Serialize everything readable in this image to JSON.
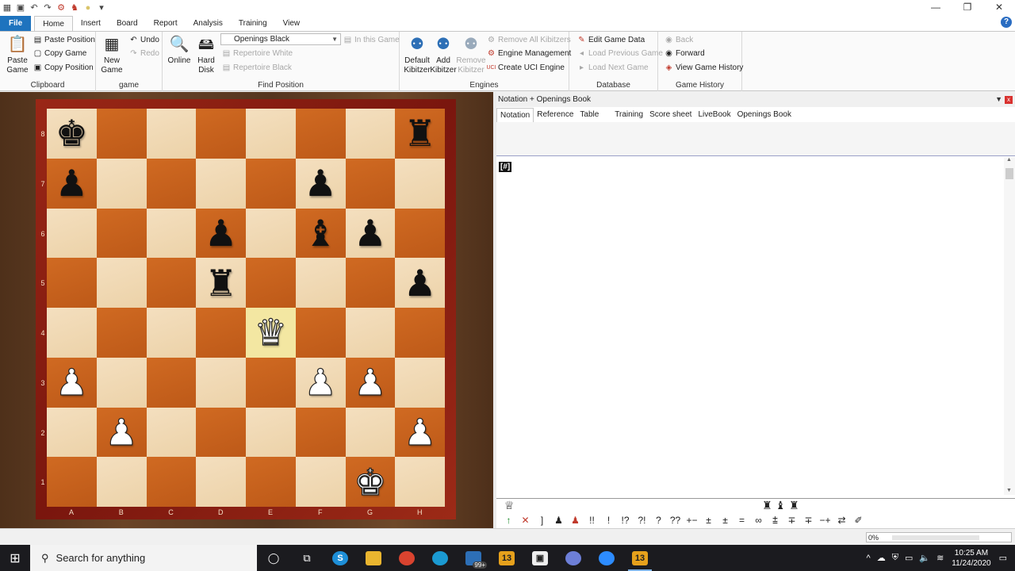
{
  "titlebar": {
    "minimize": "—",
    "maximize": "❐",
    "close": "✕"
  },
  "tabs": [
    "File",
    "Home",
    "Insert",
    "Board",
    "Report",
    "Analysis",
    "Training",
    "View"
  ],
  "help": "?",
  "ribbon": {
    "clipboard": {
      "label": "Clipboard",
      "paste_game": "Paste Game",
      "paste_position": "Paste Position",
      "copy_game": "Copy Game",
      "copy_position": "Copy Position"
    },
    "game": {
      "label": "game",
      "new_game": "New Game",
      "undo": "Undo",
      "redo": "Redo"
    },
    "find": {
      "label": "Find Position",
      "online": "Online",
      "hard_disk": "Hard Disk",
      "opening_select": "Openings Black",
      "in_this_game": "In this Game",
      "repertoire_white": "Repertoire White",
      "repertoire_black": "Repertoire Black"
    },
    "engines": {
      "label": "Engines",
      "default_kibitzer": "Default Kibitzer",
      "add_kibitzer": "Add Kibitzer",
      "remove_kibitzer": "Remove Kibitzer",
      "remove_all": "Remove All Kibitzers",
      "engine_management": "Engine Management",
      "create_uci": "Create UCI Engine"
    },
    "database": {
      "label": "Database",
      "edit_game_data": "Edit Game Data",
      "load_previous": "Load Previous Game",
      "load_next": "Load Next Game"
    },
    "history": {
      "label": "Game History",
      "back": "Back",
      "forward": "Forward",
      "view_history": "View Game History"
    }
  },
  "board": {
    "ranks": [
      "8",
      "7",
      "6",
      "5",
      "4",
      "3",
      "2",
      "1"
    ],
    "files": [
      "A",
      "B",
      "C",
      "D",
      "E",
      "F",
      "G",
      "H"
    ],
    "highlight": "e4",
    "pieces": {
      "a8": "bK",
      "h8": "bR",
      "a7": "bP",
      "f7": "bP",
      "d6": "bP",
      "f6": "bB",
      "g6": "bP",
      "d5": "bR",
      "h5": "bP",
      "e4": "wQ",
      "a3": "wP",
      "f3": "wP",
      "g3": "wP",
      "b2": "wP",
      "h2": "wP",
      "g1": "wK"
    }
  },
  "notation": {
    "title": "Notation + Openings Book",
    "pin": "▼",
    "close": "x",
    "tabs": [
      "Notation",
      "Reference",
      "Table",
      "Training",
      "Score sheet",
      "LiveBook",
      "Openings Book"
    ],
    "result_mark": "[#]",
    "material_left": "♕",
    "material_right": "♜ ♝ ♜",
    "symbols": [
      "↑",
      "✕",
      "]",
      "♟",
      "♟",
      "!!",
      "!",
      "!?",
      "?!",
      "?",
      "??",
      "+−",
      "±",
      "±",
      "=",
      "∞",
      "⩲",
      "∓",
      "∓",
      "−+",
      "⇄",
      "✐"
    ]
  },
  "status": {
    "progress": "0%",
    "progress_value": 0
  },
  "taskbar": {
    "search": "Search for anything",
    "mail_badge": "99+",
    "time": "10:25 AM",
    "date": "11/24/2020"
  }
}
